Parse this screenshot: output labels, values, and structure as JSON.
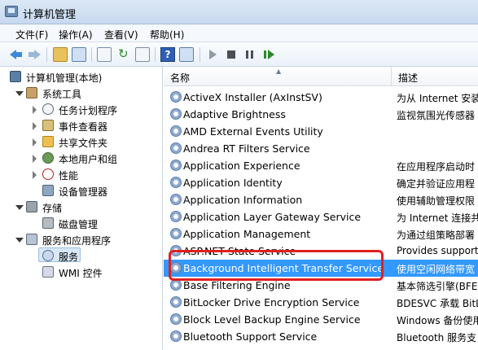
{
  "window": {
    "title": "计算机管理"
  },
  "menu": [
    "文件(F)",
    "操作(A)",
    "查看(V)",
    "帮助(H)"
  ],
  "toolbar": {
    "icons": [
      "back-arrow-icon",
      "forward-arrow-icon",
      "up-folder-icon",
      "show-tree-icon",
      "properties-icon",
      "refresh-icon",
      "export-icon",
      "help-icon",
      "details-icon",
      "start-service-icon",
      "stop-service-icon",
      "pause-service-icon",
      "resume-service-icon"
    ]
  },
  "tree": {
    "root": "计算机管理(本地)",
    "system_tools": "系统工具",
    "task_scheduler": "任务计划程序",
    "event_viewer": "事件查看器",
    "shared_folders": "共享文件夹",
    "local_users": "本地用户和组",
    "performance": "性能",
    "device_manager": "设备管理器",
    "storage": "存储",
    "disk_management": "磁盘管理",
    "services_apps": "服务和应用程序",
    "services": "服务",
    "wmi": "WMI 控件"
  },
  "list": {
    "columns": {
      "name": "名称",
      "desc": "描述"
    },
    "rows": [
      {
        "name": "ActiveX Installer (AxInstSV)",
        "desc": "为从 Internet 安装"
      },
      {
        "name": "Adaptive Brightness",
        "desc": "监视氛围光传感器"
      },
      {
        "name": "AMD External Events Utility",
        "desc": ""
      },
      {
        "name": "Andrea RT Filters Service",
        "desc": ""
      },
      {
        "name": "Application Experience",
        "desc": "在应用程序启动时"
      },
      {
        "name": "Application Identity",
        "desc": "确定并验证应用程"
      },
      {
        "name": "Application Information",
        "desc": "使用辅助管理权限"
      },
      {
        "name": "Application Layer Gateway Service",
        "desc": "为 Internet 连接共"
      },
      {
        "name": "Application Management",
        "desc": "为通过组策略部署"
      },
      {
        "name": "ASP.NET State Service",
        "desc": "Provides support"
      },
      {
        "name": "Background Intelligent Transfer Service",
        "desc": "使用空闲网络带宽"
      },
      {
        "name": "Base Filtering Engine",
        "desc": "基本筛选引擎(BFE)"
      },
      {
        "name": "BitLocker Drive Encryption Service",
        "desc": "BDESVC 承载 BitL"
      },
      {
        "name": "Block Level Backup Engine Service",
        "desc": "Windows 备份使用"
      },
      {
        "name": "Bluetooth Support Service",
        "desc": "Bluetooth 服务支"
      }
    ]
  },
  "colors": {
    "selection": "#3399ff",
    "highlight": "#e02020"
  }
}
